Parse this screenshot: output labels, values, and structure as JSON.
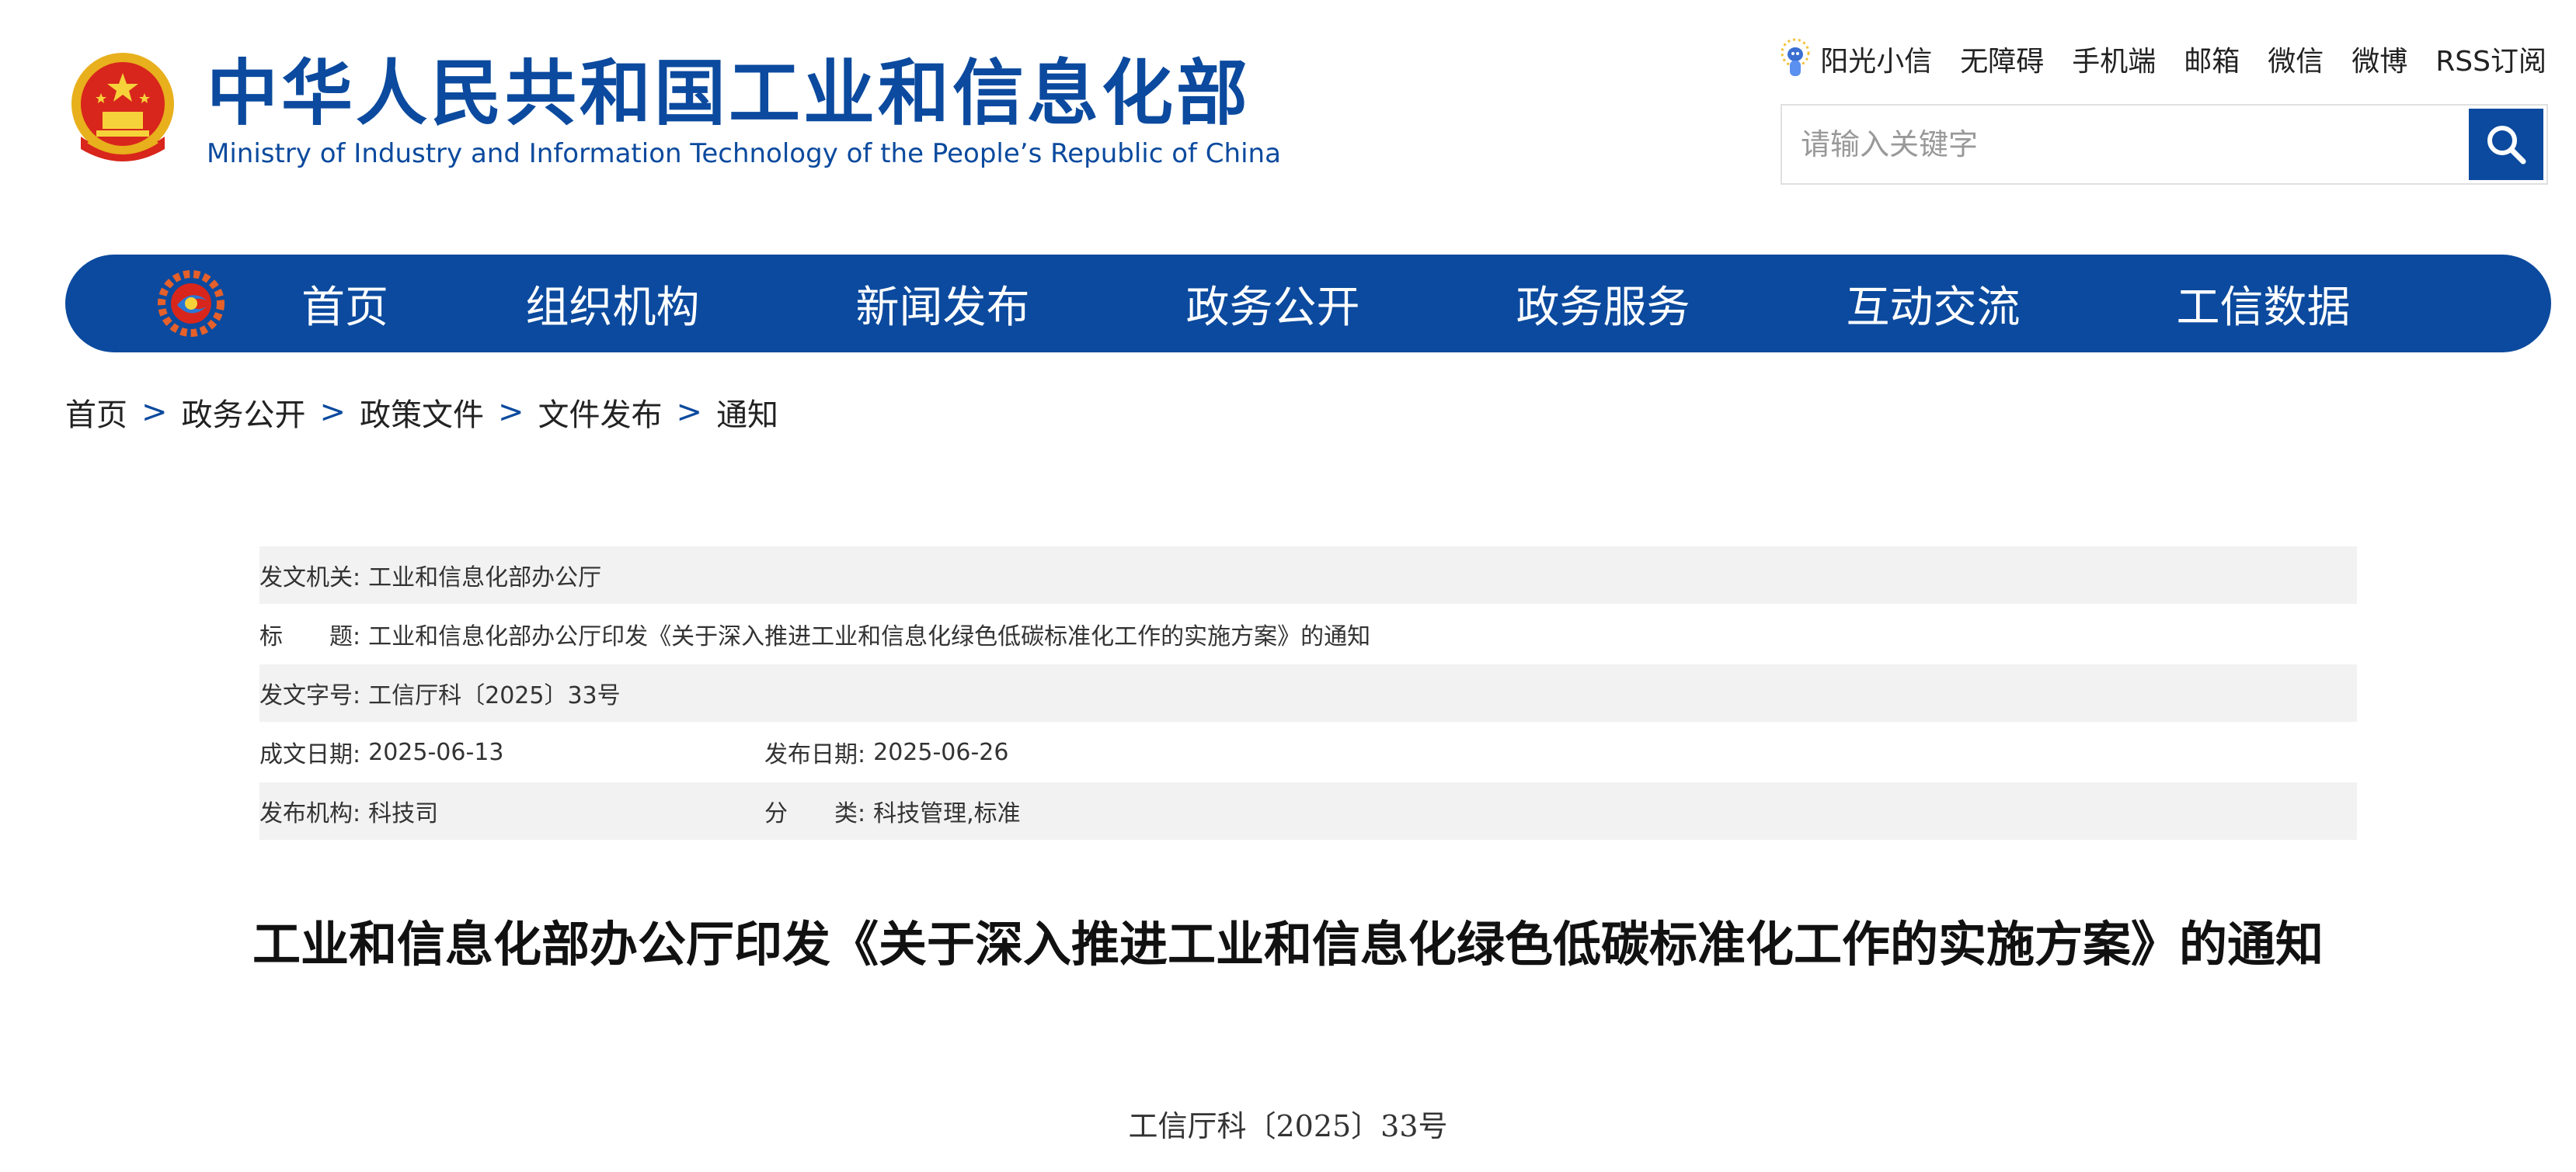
{
  "header": {
    "title_cn": "中华人民共和国工业和信息化部",
    "title_en": "Ministry of Industry and Information Technology of the People’s Republic of China",
    "top_links": [
      "阳光小信",
      "无障碍",
      "手机端",
      "邮箱",
      "微信",
      "微博",
      "RSS订阅"
    ],
    "search_placeholder": "请输入关键字"
  },
  "nav": {
    "items": [
      "首页",
      "组织机构",
      "新闻发布",
      "政务公开",
      "政务服务",
      "互动交流",
      "工信数据"
    ]
  },
  "breadcrumb": {
    "items": [
      "首页",
      "政务公开",
      "政策文件",
      "文件发布",
      "通知"
    ],
    "separator": ">"
  },
  "meta": {
    "issuer_label": "发文机关:",
    "issuer": "工业和信息化部办公厅",
    "title_label": "标　　题:",
    "title": "工业和信息化部办公厅印发《关于深入推进工业和信息化绿色低碳标准化工作的实施方案》的通知",
    "doc_no_label": "发文字号:",
    "doc_no": "工信厅科〔2025〕33号",
    "written_label": "成文日期:",
    "written": "2025-06-13",
    "published_label": "发布日期:",
    "published": "2025-06-26",
    "org_label": "发布机构:",
    "org": "科技司",
    "category_label": "分　　类:",
    "category": "科技管理,标准"
  },
  "article": {
    "title": "工业和信息化部办公厅印发《关于深入推进工业和信息化绿色低碳标准化工作的实施方案》的通知",
    "doc_number": "工信厅科〔2025〕33号"
  },
  "colors": {
    "brand_blue": "#0b4a9e",
    "meta_shade": "#f2f2f2"
  }
}
